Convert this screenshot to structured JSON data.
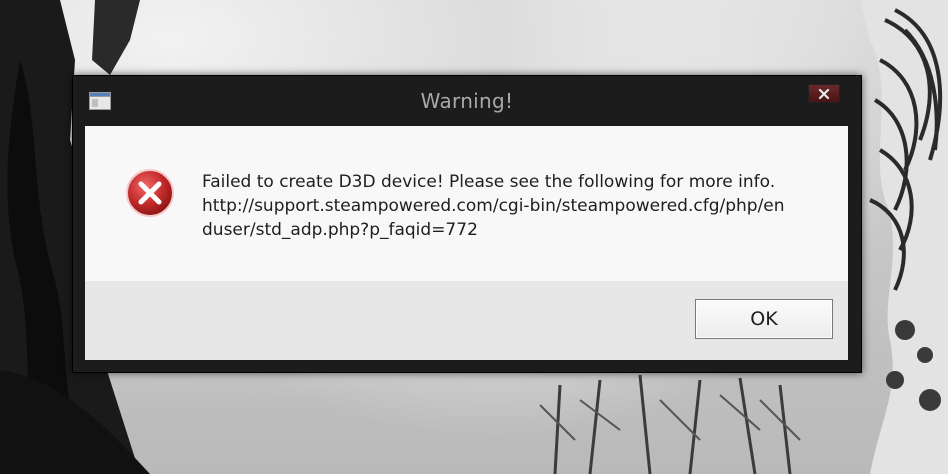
{
  "dialog": {
    "title": "Warning!",
    "icon": "error-icon",
    "message_lines": [
      "Failed to create D3D device! Please see the following for more info.",
      "http://support.steampowered.com/cgi-bin/steampowered.cfg/php/en",
      "duser/std_adp.php?p_faqid=772"
    ],
    "ok_label": "OK",
    "close_icon": "close-icon"
  },
  "colors": {
    "title_bar": "#1c1c1c",
    "title_text": "#a8a8a8",
    "close_button": "#5a1e1e",
    "error_icon": "#c42b2b",
    "message_area": "#f8f8f8",
    "button_area": "#e7e7e7"
  }
}
